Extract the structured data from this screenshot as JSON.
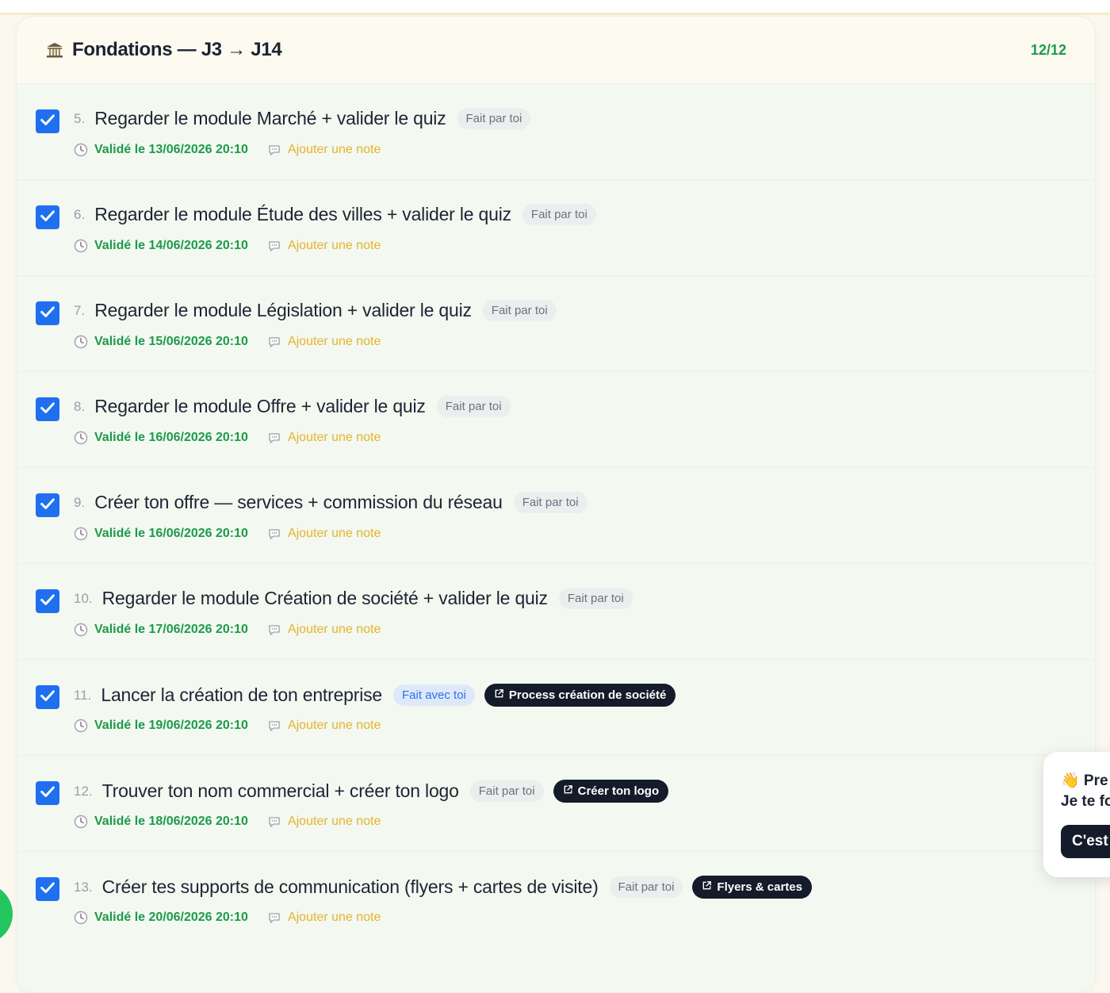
{
  "section": {
    "title": "Fondations — J3 → J14",
    "progress": "12/12",
    "icon": "bank-icon"
  },
  "tasks": [
    {
      "num": "5.",
      "title": "Regarder le module Marché + valider le quiz",
      "chip": "Fait par toi",
      "validated": "Validé le 13/06/2026 20:10",
      "note": "Ajouter une note"
    },
    {
      "num": "6.",
      "title": "Regarder le module Étude des villes + valider le quiz",
      "chip": "Fait par toi",
      "validated": "Validé le 14/06/2026 20:10",
      "note": "Ajouter une note"
    },
    {
      "num": "7.",
      "title": "Regarder le module Législation + valider le quiz",
      "chip": "Fait par toi",
      "validated": "Validé le 15/06/2026 20:10",
      "note": "Ajouter une note"
    },
    {
      "num": "8.",
      "title": "Regarder le module Offre + valider le quiz",
      "chip": "Fait par toi",
      "validated": "Validé le 16/06/2026 20:10",
      "note": "Ajouter une note"
    },
    {
      "num": "9.",
      "title": "Créer ton offre — services + commission du réseau",
      "chip": "Fait par toi",
      "validated": "Validé le 16/06/2026 20:10",
      "note": "Ajouter une note"
    },
    {
      "num": "10.",
      "title": "Regarder le module Création de société + valider le quiz",
      "chip": "Fait par toi",
      "validated": "Validé le 17/06/2026 20:10",
      "note": "Ajouter une note"
    },
    {
      "num": "11.",
      "title": "Lancer la création de ton entreprise",
      "chip": "Fait avec toi",
      "link": "Process création de société",
      "validated": "Validé le 19/06/2026 20:10",
      "note": "Ajouter une note"
    },
    {
      "num": "12.",
      "title": "Trouver ton nom commercial + créer ton logo",
      "chip": "Fait par toi",
      "link": "Créer ton logo",
      "validated": "Validé le 18/06/2026 20:10",
      "note": "Ajouter une note"
    },
    {
      "num": "13.",
      "title": "Créer tes supports de communication (flyers + cartes de visite)",
      "chip": "Fait par toi",
      "link": "Flyers & cartes",
      "validated": "Validé le 20/06/2026 20:10",
      "note": "Ajouter une note"
    }
  ],
  "popup": {
    "line1": "👋 Pre",
    "line2": "Je te fo",
    "button": "C'est"
  },
  "colors": {
    "checkbox": "#1f6ff0",
    "validated": "#1e9a4a",
    "note": "#e6b32a",
    "progress": "#1e9a4a",
    "dark_pill": "#141b2a"
  }
}
